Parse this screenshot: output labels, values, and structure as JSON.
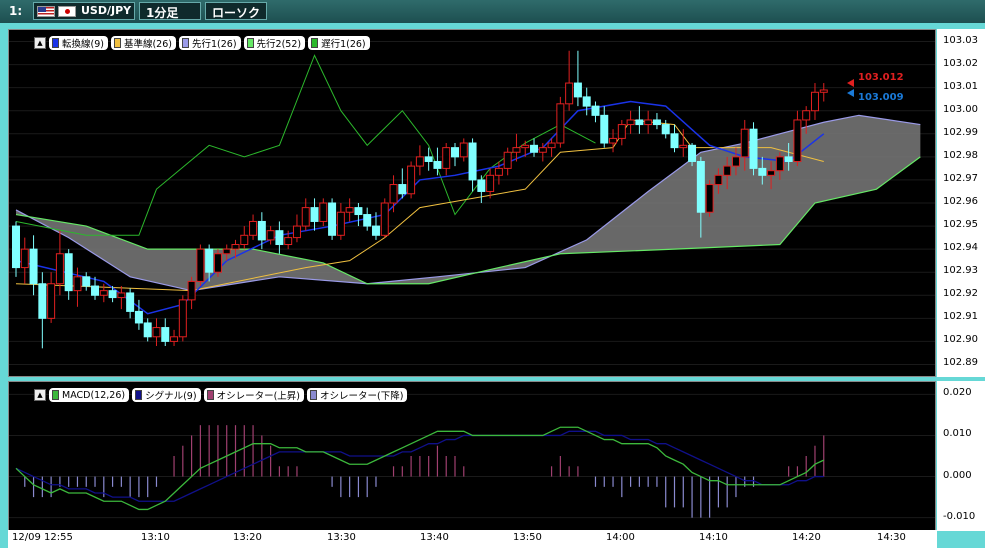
{
  "toolbar": {
    "chart_no": "1:",
    "pair": "USD/JPY",
    "timeframe": "1分足",
    "chart_type": "ローソク"
  },
  "main_legend": [
    {
      "label": "転換線(9)",
      "color": "#1a33e8"
    },
    {
      "label": "基準線(26)",
      "color": "#f0c040"
    },
    {
      "label": "先行1(26)",
      "color": "#9a9ae8"
    },
    {
      "label": "先行2(52)",
      "color": "#66e866"
    },
    {
      "label": "遅行1(26)",
      "color": "#2cb82c"
    }
  ],
  "macd_legend": [
    {
      "label": "MACD(12,26)",
      "color": "#3cb83c"
    },
    {
      "label": "シグナル(9)",
      "color": "#10108a"
    },
    {
      "label": "オシレーター(上昇)",
      "color": "#a04070"
    },
    {
      "label": "オシレーター(下降)",
      "color": "#8a8ad0"
    }
  ],
  "price_axis": [
    "103.03",
    "103.02",
    "103.01",
    "103.00",
    "102.99",
    "102.98",
    "102.97",
    "102.96",
    "102.95",
    "102.94",
    "102.93",
    "102.92",
    "102.91",
    "102.90",
    "102.89"
  ],
  "macd_axis": [
    "0.020",
    "0.010",
    "0.000",
    "-0.010"
  ],
  "time_axis": [
    "12/09 12:55",
    "13:10",
    "13:20",
    "13:30",
    "13:40",
    "13:50",
    "14:00",
    "14:10",
    "14:20",
    "14:30"
  ],
  "price_tags": {
    "ask": "103.012",
    "bid": "103.009",
    "ask_color": "#e02020",
    "bid_color": "#1a7ad8"
  },
  "chart_data": {
    "type": "candlestick",
    "time_start": "12:55",
    "interval": "1 minute",
    "ylim": [
      102.885,
      103.035
    ],
    "candles": [
      [
        102.95,
        102.952,
        102.928,
        102.932
      ],
      [
        102.932,
        102.945,
        102.925,
        102.94
      ],
      [
        102.94,
        102.946,
        102.92,
        102.925
      ],
      [
        102.925,
        102.93,
        102.897,
        102.91
      ],
      [
        102.91,
        102.93,
        102.908,
        102.925
      ],
      [
        102.925,
        102.948,
        102.92,
        102.938
      ],
      [
        102.938,
        102.94,
        102.918,
        102.922
      ],
      [
        102.922,
        102.932,
        102.915,
        102.928
      ],
      [
        102.928,
        102.93,
        102.922,
        102.924
      ],
      [
        102.924,
        102.928,
        102.918,
        102.92
      ],
      [
        102.92,
        102.925,
        102.917,
        102.922
      ],
      [
        102.922,
        102.924,
        102.917,
        102.919
      ],
      [
        102.919,
        102.924,
        102.914,
        102.921
      ],
      [
        102.921,
        102.923,
        102.91,
        102.913
      ],
      [
        102.913,
        102.918,
        102.905,
        102.908
      ],
      [
        102.908,
        102.91,
        102.9,
        102.902
      ],
      [
        102.902,
        102.91,
        102.898,
        102.906
      ],
      [
        102.906,
        102.91,
        102.898,
        102.9
      ],
      [
        102.9,
        102.905,
        102.898,
        102.902
      ],
      [
        102.902,
        102.92,
        102.9,
        102.918
      ],
      [
        102.918,
        102.928,
        102.914,
        102.926
      ],
      [
        102.926,
        102.942,
        102.924,
        102.94
      ],
      [
        102.94,
        102.942,
        102.926,
        102.93
      ],
      [
        102.93,
        102.94,
        102.928,
        102.938
      ],
      [
        102.938,
        102.942,
        102.935,
        102.94
      ],
      [
        102.94,
        102.944,
        102.936,
        102.942
      ],
      [
        102.942,
        102.95,
        102.94,
        102.946
      ],
      [
        102.946,
        102.955,
        102.944,
        102.952
      ],
      [
        102.952,
        102.956,
        102.94,
        102.944
      ],
      [
        102.944,
        102.95,
        102.942,
        102.948
      ],
      [
        102.948,
        102.952,
        102.938,
        102.942
      ],
      [
        102.942,
        102.948,
        102.94,
        102.945
      ],
      [
        102.945,
        102.955,
        102.943,
        102.95
      ],
      [
        102.95,
        102.962,
        102.948,
        102.958
      ],
      [
        102.958,
        102.962,
        102.948,
        102.952
      ],
      [
        102.952,
        102.962,
        102.95,
        102.96
      ],
      [
        102.96,
        102.962,
        102.944,
        102.946
      ],
      [
        102.946,
        102.96,
        102.944,
        102.956
      ],
      [
        102.956,
        102.962,
        102.952,
        102.958
      ],
      [
        102.958,
        102.96,
        102.95,
        102.955
      ],
      [
        102.955,
        102.958,
        102.948,
        102.95
      ],
      [
        102.95,
        102.956,
        102.944,
        102.946
      ],
      [
        102.946,
        102.962,
        102.945,
        102.96
      ],
      [
        102.96,
        102.972,
        102.956,
        102.968
      ],
      [
        102.968,
        102.975,
        102.962,
        102.964
      ],
      [
        102.964,
        102.978,
        102.962,
        102.976
      ],
      [
        102.976,
        102.985,
        102.972,
        102.98
      ],
      [
        102.98,
        102.984,
        102.974,
        102.978
      ],
      [
        102.978,
        102.984,
        102.972,
        102.975
      ],
      [
        102.975,
        102.986,
        102.972,
        102.984
      ],
      [
        102.984,
        102.986,
        102.976,
        102.98
      ],
      [
        102.98,
        102.988,
        102.978,
        102.986
      ],
      [
        102.986,
        102.988,
        102.965,
        102.97
      ],
      [
        102.97,
        102.972,
        102.96,
        102.965
      ],
      [
        102.965,
        102.975,
        102.962,
        102.972
      ],
      [
        102.972,
        102.978,
        102.968,
        102.975
      ],
      [
        102.975,
        102.984,
        102.972,
        102.982
      ],
      [
        102.982,
        102.99,
        102.978,
        102.984
      ],
      [
        102.984,
        102.987,
        102.98,
        102.985
      ],
      [
        102.985,
        102.988,
        102.98,
        102.982
      ],
      [
        102.982,
        102.986,
        102.978,
        102.984
      ],
      [
        102.984,
        102.988,
        102.98,
        102.986
      ],
      [
        102.986,
        103.006,
        102.984,
        103.003
      ],
      [
        103.003,
        103.026,
        103.0,
        103.012
      ],
      [
        103.012,
        103.026,
        103.002,
        103.006
      ],
      [
        103.006,
        103.01,
        102.998,
        103.002
      ],
      [
        103.002,
        103.004,
        102.995,
        102.998
      ],
      [
        102.998,
        103.002,
        102.984,
        102.986
      ],
      [
        102.986,
        102.992,
        102.982,
        102.988
      ],
      [
        102.988,
        102.996,
        102.985,
        102.994
      ],
      [
        102.994,
        103.0,
        102.99,
        102.996
      ],
      [
        102.996,
        103.002,
        102.99,
        102.994
      ],
      [
        102.994,
        103.0,
        102.99,
        102.996
      ],
      [
        102.996,
        102.999,
        102.992,
        102.994
      ],
      [
        102.994,
        102.996,
        102.988,
        102.99
      ],
      [
        102.99,
        102.994,
        102.982,
        102.984
      ],
      [
        102.984,
        102.992,
        102.98,
        102.985
      ],
      [
        102.985,
        102.986,
        102.976,
        102.978
      ],
      [
        102.978,
        102.98,
        102.945,
        102.956
      ],
      [
        102.956,
        102.97,
        102.954,
        102.968
      ],
      [
        102.968,
        102.975,
        102.964,
        102.972
      ],
      [
        102.972,
        102.98,
        102.966,
        102.976
      ],
      [
        102.976,
        102.984,
        102.972,
        102.98
      ],
      [
        102.98,
        102.996,
        102.974,
        102.992
      ],
      [
        102.992,
        102.995,
        102.972,
        102.975
      ],
      [
        102.975,
        102.98,
        102.968,
        102.972
      ],
      [
        102.972,
        102.978,
        102.966,
        102.974
      ],
      [
        102.974,
        102.982,
        102.97,
        102.98
      ],
      [
        102.98,
        102.986,
        102.974,
        102.978
      ],
      [
        102.978,
        103.0,
        102.976,
        102.996
      ],
      [
        102.996,
        103.002,
        102.99,
        103.0
      ],
      [
        103.0,
        103.012,
        102.996,
        103.008
      ],
      [
        103.008,
        103.012,
        103.004,
        103.009
      ]
    ],
    "macd": [
      0.002,
      0.0,
      -0.002,
      -0.003,
      -0.004,
      -0.003,
      -0.004,
      -0.004,
      -0.004,
      -0.005,
      -0.006,
      -0.006,
      -0.006,
      -0.007,
      -0.008,
      -0.008,
      -0.007,
      -0.006,
      -0.004,
      -0.002,
      0.0,
      0.002,
      0.003,
      0.004,
      0.005,
      0.006,
      0.007,
      0.008,
      0.008,
      0.008,
      0.007,
      0.007,
      0.007,
      0.006,
      0.006,
      0.006,
      0.005,
      0.004,
      0.003,
      0.003,
      0.003,
      0.004,
      0.005,
      0.006,
      0.007,
      0.008,
      0.009,
      0.01,
      0.011,
      0.011,
      0.011,
      0.011,
      0.01,
      0.01,
      0.01,
      0.01,
      0.01,
      0.01,
      0.01,
      0.01,
      0.01,
      0.011,
      0.012,
      0.012,
      0.012,
      0.011,
      0.01,
      0.009,
      0.009,
      0.008,
      0.008,
      0.008,
      0.008,
      0.007,
      0.005,
      0.004,
      0.003,
      0.001,
      0.0,
      -0.001,
      -0.001,
      -0.002,
      -0.002,
      -0.002,
      -0.002,
      -0.002,
      -0.002,
      -0.002,
      -0.001,
      0.0,
      0.001,
      0.003,
      0.004
    ],
    "signal": [
      0.002,
      0.001,
      0.0,
      -0.001,
      -0.002,
      -0.002,
      -0.003,
      -0.003,
      -0.003,
      -0.004,
      -0.004,
      -0.005,
      -0.005,
      -0.005,
      -0.006,
      -0.006,
      -0.006,
      -0.006,
      -0.006,
      -0.005,
      -0.004,
      -0.003,
      -0.002,
      -0.001,
      0.0,
      0.001,
      0.002,
      0.003,
      0.004,
      0.005,
      0.006,
      0.006,
      0.006,
      0.006,
      0.006,
      0.006,
      0.006,
      0.006,
      0.005,
      0.005,
      0.005,
      0.005,
      0.005,
      0.005,
      0.006,
      0.006,
      0.007,
      0.008,
      0.008,
      0.009,
      0.009,
      0.01,
      0.01,
      0.01,
      0.01,
      0.01,
      0.01,
      0.01,
      0.01,
      0.01,
      0.01,
      0.01,
      0.01,
      0.011,
      0.011,
      0.011,
      0.011,
      0.01,
      0.01,
      0.01,
      0.009,
      0.009,
      0.009,
      0.008,
      0.008,
      0.007,
      0.006,
      0.005,
      0.004,
      0.003,
      0.002,
      0.001,
      0.0,
      -0.001,
      -0.001,
      -0.002,
      -0.002,
      -0.002,
      -0.002,
      -0.001,
      -0.001,
      0.0,
      0.0
    ],
    "lines": {
      "tenkan": [
        [
          0,
          102.935
        ],
        [
          10,
          102.926
        ],
        [
          15,
          102.912
        ],
        [
          19,
          102.916
        ],
        [
          24,
          102.935
        ],
        [
          30,
          102.946
        ],
        [
          36,
          102.95
        ],
        [
          42,
          102.955
        ],
        [
          46,
          102.97
        ],
        [
          50,
          102.972
        ],
        [
          55,
          102.976
        ],
        [
          60,
          102.984
        ],
        [
          64,
          103.0
        ],
        [
          70,
          103.004
        ],
        [
          74,
          103.002
        ],
        [
          79,
          102.985
        ],
        [
          83,
          102.98
        ],
        [
          88,
          102.978
        ],
        [
          92,
          102.99
        ]
      ],
      "kijun": [
        [
          0,
          102.925
        ],
        [
          20,
          102.922
        ],
        [
          33,
          102.932
        ],
        [
          38,
          102.935
        ],
        [
          42,
          102.945
        ],
        [
          46,
          102.958
        ],
        [
          58,
          102.966
        ],
        [
          62,
          102.982
        ],
        [
          68,
          102.984
        ],
        [
          70,
          102.996
        ],
        [
          75,
          102.994
        ],
        [
          77,
          102.984
        ],
        [
          86,
          102.984
        ],
        [
          92,
          102.978
        ]
      ],
      "senkou1": [
        [
          0,
          102.957
        ],
        [
          6,
          102.945
        ],
        [
          13,
          102.928
        ],
        [
          20,
          102.922
        ],
        [
          30,
          102.928
        ],
        [
          40,
          102.925
        ],
        [
          48,
          102.928
        ],
        [
          58,
          102.932
        ],
        [
          65,
          102.944
        ],
        [
          72,
          102.965
        ],
        [
          78,
          102.982
        ],
        [
          83,
          102.986
        ],
        [
          92,
          102.995
        ],
        [
          96,
          102.998
        ],
        [
          103,
          102.994
        ]
      ],
      "senkou2": [
        [
          0,
          102.955
        ],
        [
          8,
          102.95
        ],
        [
          15,
          102.94
        ],
        [
          27,
          102.94
        ],
        [
          35,
          102.934
        ],
        [
          40,
          102.925
        ],
        [
          47,
          102.925
        ],
        [
          55,
          102.932
        ],
        [
          62,
          102.938
        ],
        [
          75,
          102.94
        ],
        [
          87,
          102.942
        ],
        [
          91,
          102.96
        ],
        [
          98,
          102.966
        ],
        [
          103,
          102.98
        ]
      ],
      "chikou": [
        [
          0,
          102.952
        ],
        [
          8,
          102.946
        ],
        [
          14,
          102.946
        ],
        [
          16,
          102.966
        ],
        [
          22,
          102.985
        ],
        [
          26,
          102.98
        ],
        [
          30,
          102.985
        ],
        [
          34,
          103.024
        ],
        [
          37,
          103.0
        ],
        [
          40,
          102.985
        ],
        [
          44,
          103.0
        ],
        [
          47,
          102.985
        ],
        [
          50,
          102.955
        ],
        [
          54,
          102.975
        ],
        [
          58,
          102.986
        ],
        [
          62,
          102.994
        ],
        [
          66,
          102.986
        ]
      ]
    }
  }
}
